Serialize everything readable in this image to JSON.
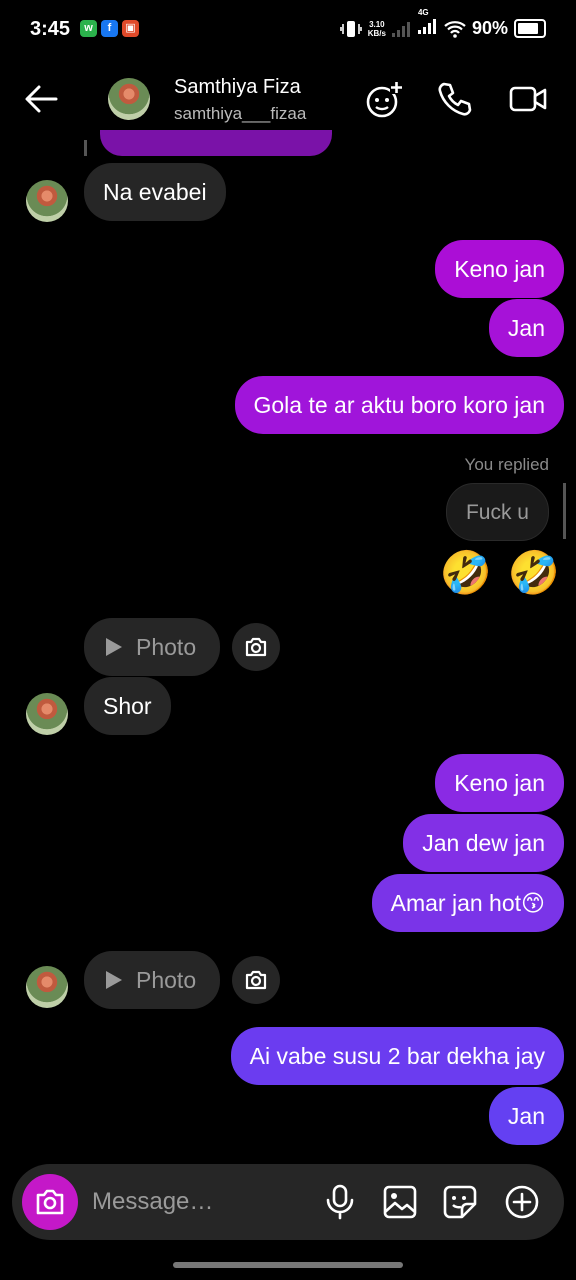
{
  "status_bar": {
    "time": "3:45",
    "net_speed": "3.10",
    "net_unit": "KB/s",
    "network": "4G",
    "battery": "90%"
  },
  "header": {
    "name": "Samthiya Fiza",
    "username": "samthiya___fizaa",
    "icons": [
      "back-arrow-icon",
      "effects-plus-icon",
      "phone-icon",
      "video-call-icon"
    ]
  },
  "messages": [
    {
      "from": "them",
      "text": "Na evabei"
    },
    {
      "from": "me",
      "text": "Keno jan"
    },
    {
      "from": "me",
      "text": "Jan"
    },
    {
      "from": "me",
      "text": "Gola te ar aktu boro koro jan"
    },
    {
      "from": "me",
      "reply_label": "You replied",
      "text": "Fuck u"
    },
    {
      "from": "me",
      "text": "🤣 🤣"
    },
    {
      "from": "them",
      "text": "Photo"
    },
    {
      "from": "them",
      "text": "Shor"
    },
    {
      "from": "me",
      "text": "Keno jan"
    },
    {
      "from": "me",
      "text": "Jan dew jan"
    },
    {
      "from": "me",
      "text": "Amar jan hot😙"
    },
    {
      "from": "them",
      "text": "Photo"
    },
    {
      "from": "me",
      "text": "Ai vabe susu 2 bar dekha jay"
    },
    {
      "from": "me",
      "text": "Jan"
    }
  ],
  "composer": {
    "placeholder": "Message…",
    "icons": [
      "camera-icon",
      "microphone-icon",
      "gallery-icon",
      "sticker-icon",
      "plus-icon"
    ]
  },
  "colors": {
    "background": "#000000",
    "incoming_bubble": "#262626",
    "outgoing_top": "#b010d8",
    "outgoing_bottom": "#6a3cf2",
    "camera_button": "#c418c8"
  }
}
